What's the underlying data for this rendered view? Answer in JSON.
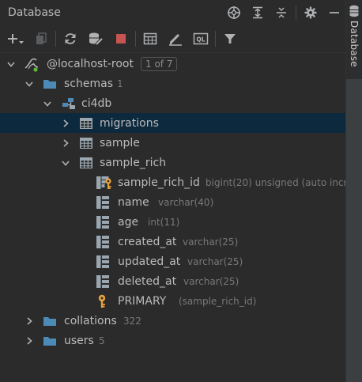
{
  "panel": {
    "title": "Database"
  },
  "header_icons": [
    "locate-icon",
    "expand-all-icon",
    "collapse-all-icon",
    "settings-gear-icon",
    "minimize-icon"
  ],
  "toolbar": {
    "items": [
      "add-icon",
      "duplicate-icon",
      "refresh-icon",
      "data-source-properties-icon",
      "stop-icon",
      "table-editor-icon",
      "edit-icon",
      "query-console-icon",
      "filter-icon"
    ]
  },
  "side_tab": {
    "label": "Database"
  },
  "tree": {
    "datasource": {
      "label": "@localhost-root",
      "badge": "1 of 7"
    },
    "schemas": {
      "label": "schemas",
      "count": "1"
    },
    "schema": {
      "label": "ci4db"
    },
    "tables": [
      {
        "label": "migrations"
      },
      {
        "label": "sample"
      },
      {
        "label": "sample_rich"
      }
    ],
    "columns": [
      {
        "name": "sample_rich_id",
        "type": "bigint(20) unsigned (auto incr"
      },
      {
        "name": "name",
        "type": "varchar(40)"
      },
      {
        "name": "age",
        "type": "int(11)"
      },
      {
        "name": "created_at",
        "type": "varchar(25)"
      },
      {
        "name": "updated_at",
        "type": "varchar(25)"
      },
      {
        "name": "deleted_at",
        "type": "varchar(25)"
      }
    ],
    "key": {
      "name": "PRIMARY",
      "detail": "(sample_rich_id)"
    },
    "collations": {
      "label": "collations",
      "count": "322"
    },
    "users": {
      "label": "users",
      "count": "5"
    }
  },
  "colors": {
    "background": "#2b2b2b",
    "selection": "#0d293e",
    "folder": "#4c8bb8",
    "key": "#e8a33c",
    "stop": "#c75450"
  }
}
